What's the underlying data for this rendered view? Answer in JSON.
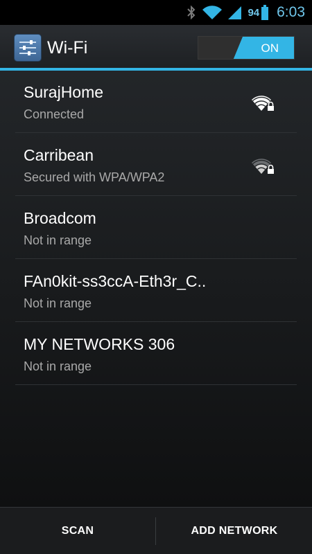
{
  "status_bar": {
    "battery_percent": "94",
    "time": "6:03",
    "icons": [
      "bluetooth-icon",
      "wifi-signal-icon",
      "cell-signal-icon",
      "battery-icon"
    ],
    "accent_color": "#6fc6ea"
  },
  "action_bar": {
    "title": "Wi-Fi",
    "icon": "settings-sliders-icon",
    "toggle_label": "ON",
    "toggle_state": "on",
    "accent_color": "#33b5e5"
  },
  "networks": [
    {
      "name": "SurajHome",
      "status": "Connected",
      "signal_icon": "wifi-lock-strong-icon"
    },
    {
      "name": "Carribean",
      "status": "Secured with WPA/WPA2",
      "signal_icon": "wifi-lock-weak-icon"
    },
    {
      "name": "Broadcom",
      "status": "Not in range"
    },
    {
      "name": "FAn0kit-ss3ccA-Eth3r_C..",
      "status": "Not in range"
    },
    {
      "name": "MY NETWORKS 306",
      "status": "Not in range"
    }
  ],
  "bottom_bar": {
    "scan_label": "SCAN",
    "add_network_label": "ADD NETWORK"
  }
}
